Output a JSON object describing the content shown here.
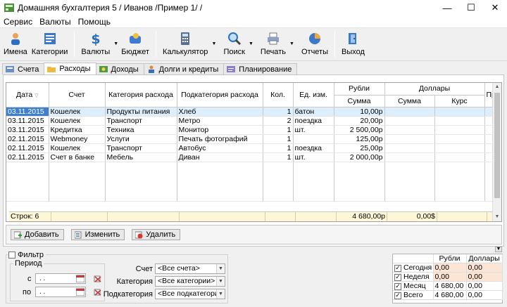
{
  "window": {
    "title": "Домашняя бухгалтерия 5  / Иванов /Пример 1/ /",
    "minimize": "—",
    "maximize": "☐",
    "close": "✕"
  },
  "menu": [
    "Сервис",
    "Валюты",
    "Помощь"
  ],
  "toolbar": {
    "names": "Имена",
    "categories": "Категории",
    "currencies": "Валюты",
    "budget": "Бюджет",
    "calculator": "Калькулятор",
    "search": "Поиск",
    "print": "Печать",
    "reports": "Отчеты",
    "exit": "Выход"
  },
  "tabs": [
    "Счета",
    "Расходы",
    "Доходы",
    "Долги и кредиты",
    "Планирование"
  ],
  "grid": {
    "headers": {
      "date": "Дата",
      "account": "Счет",
      "category": "Категория расхода",
      "subcategory": "Подкатегория расхода",
      "qty": "Кол.",
      "unit": "Ед. изм.",
      "rub_group": "Рубли",
      "rub_sum": "Сумма",
      "usd_group": "Доллары",
      "usd_sum": "Сумма",
      "usd_rate": "Курс",
      "extra": "Пр"
    },
    "rows": [
      {
        "date": "03.11.2015",
        "account": "Кошелек",
        "category": "Продукты питания",
        "subcategory": "Хлеб",
        "qty": "1",
        "unit": "батон",
        "rub": "10,00р",
        "usd": "",
        "rate": ""
      },
      {
        "date": "03.11.2015",
        "account": "Кошелек",
        "category": "Транспорт",
        "subcategory": "Метро",
        "qty": "2",
        "unit": "поездка",
        "rub": "20,00р",
        "usd": "",
        "rate": ""
      },
      {
        "date": "03.11.2015",
        "account": "Кредитка",
        "category": "Техника",
        "subcategory": "Монитор",
        "qty": "1",
        "unit": "шт.",
        "rub": "2 500,00р",
        "usd": "",
        "rate": ""
      },
      {
        "date": "02.11.2015",
        "account": "Webmoney",
        "category": "Услуги",
        "subcategory": "Печать фотографий",
        "qty": "1",
        "unit": "",
        "rub": "125,00р",
        "usd": "",
        "rate": ""
      },
      {
        "date": "02.11.2015",
        "account": "Кошелек",
        "category": "Транспорт",
        "subcategory": "Автобус",
        "qty": "1",
        "unit": "поездка",
        "rub": "25,00р",
        "usd": "",
        "rate": ""
      },
      {
        "date": "02.11.2015",
        "account": "Счет в банке",
        "category": "Мебель",
        "subcategory": "Диван",
        "qty": "1",
        "unit": "шт.",
        "rub": "2 000,00р",
        "usd": "",
        "rate": ""
      }
    ],
    "totals": {
      "rows_label": "Строк: 6",
      "rub": "4 680,00р",
      "usd": "0,00$"
    }
  },
  "buttons": {
    "add": "Добавить",
    "edit": "Изменить",
    "delete": "Удалить"
  },
  "filter": {
    "label": "Фильтр",
    "period": "Период",
    "from": "с",
    "to": "по",
    "from_value": " .  .",
    "to_value": " .  .",
    "account_label": "Счет",
    "account_value": "<Все счета>",
    "category_label": "Категория",
    "category_value": "<Все категории>",
    "subcategory_label": "Подкатегория",
    "subcategory_value": "<Все подкатегории>"
  },
  "summary": {
    "col_rub": "Рубли",
    "col_usd": "Доллары",
    "rows": [
      {
        "label": "Сегодня",
        "rub": "0,00",
        "usd": "0,00"
      },
      {
        "label": "Неделя",
        "rub": "0,00",
        "usd": "0,00"
      },
      {
        "label": "Месяц",
        "rub": "4 680,00",
        "usd": "0,00"
      },
      {
        "label": "Всего",
        "rub": "4 680,00",
        "usd": "0,00"
      }
    ]
  }
}
